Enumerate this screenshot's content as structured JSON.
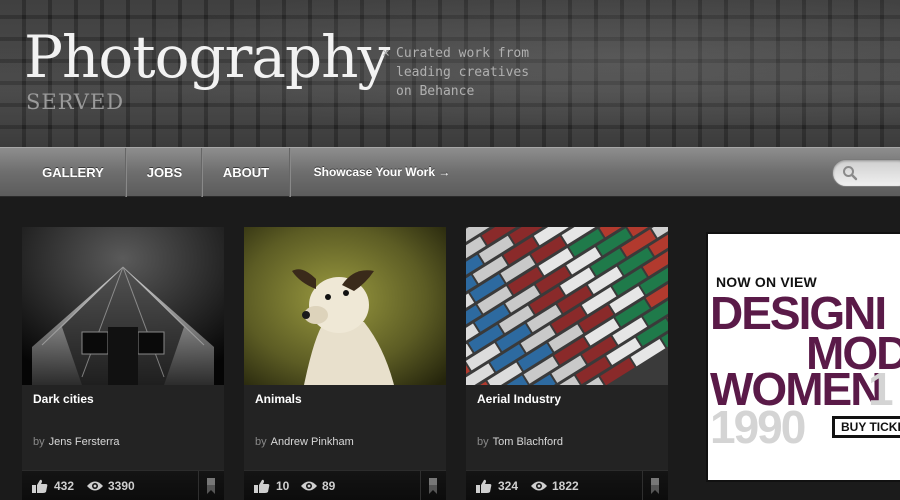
{
  "header": {
    "logo_title": "Photography",
    "logo_subtitle": "SERVED",
    "tagline_mark": "×",
    "tagline_lines": [
      "Curated work from",
      "leading creatives",
      "on Behance"
    ]
  },
  "nav": {
    "gallery": "GALLERY",
    "jobs": "JOBS",
    "about": "ABOUT",
    "showcase": "Showcase Your Work →"
  },
  "search": {
    "placeholder": ""
  },
  "cards": [
    {
      "title": "Dark cities",
      "by": "by",
      "author": "Jens Fersterra",
      "likes": "432",
      "views": "3390"
    },
    {
      "title": "Animals",
      "by": "by",
      "author": "Andrew Pinkham",
      "likes": "10",
      "views": "89"
    },
    {
      "title": "Aerial Industry",
      "by": "by",
      "author": "Tom Blachford",
      "likes": "324",
      "views": "1822"
    }
  ],
  "ad": {
    "now_on_view": "NOW ON VIEW",
    "line1": "DESIGNI",
    "line2": "MOD",
    "line3": "WOMEN",
    "year_part1": "1",
    "year_part2": "1990",
    "cta": "BUY TICKE"
  },
  "colors": {
    "background": "#1b1b1b",
    "ad_accent": "#5a1a48"
  },
  "icons": [
    "search-icon",
    "thumbs-up-icon",
    "eye-icon",
    "feature-ribbon-icon"
  ]
}
